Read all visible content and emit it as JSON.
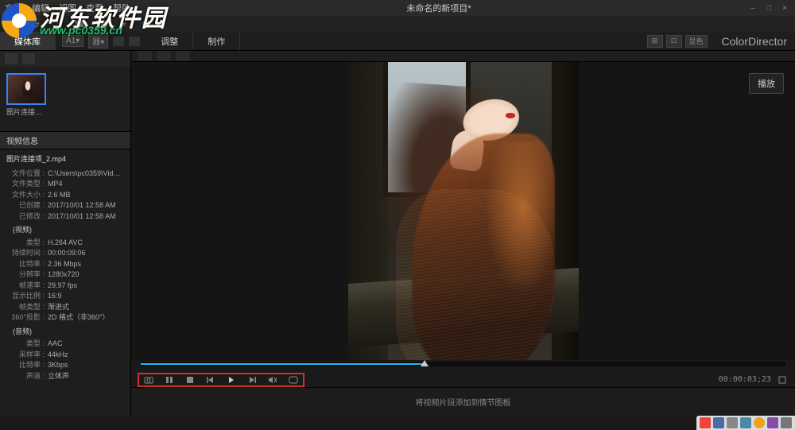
{
  "menubar": {
    "items": [
      "文件",
      "编辑",
      "视图",
      "查看",
      "帮助"
    ],
    "title": "未命名的新项目*",
    "win": [
      "–",
      "□",
      "×"
    ]
  },
  "tabs": {
    "media": "媒体库",
    "adjust": "调整",
    "make": "制作"
  },
  "subtool": {
    "dd1": "A1▾",
    "dd2": "器▾"
  },
  "brand": "ColorDirector",
  "right_icons": {
    "a": "⊞",
    "b": "⊡",
    "c": "显色"
  },
  "thumb": {
    "label": "图片连接项_2..."
  },
  "section_head": "视频信息",
  "info": {
    "file_title": "图片连接项_2.mp4",
    "rows_file": [
      {
        "k": "文件位置",
        "v": "C:\\Users\\pc0359\\Videos..."
      },
      {
        "k": "文件类型",
        "v": "MP4"
      },
      {
        "k": "文件大小",
        "v": "2.6 MB"
      },
      {
        "k": "已创建",
        "v": "2017/10/01 12:58 AM"
      },
      {
        "k": "已修改",
        "v": "2017/10/01 12:58 AM"
      }
    ],
    "grp_video": "(视频)",
    "rows_video": [
      {
        "k": "类型",
        "v": "H.264 AVC"
      },
      {
        "k": "持续时间",
        "v": "00:00:09:06"
      },
      {
        "k": "比特率",
        "v": "2.36 Mbps"
      },
      {
        "k": "分辨率",
        "v": "1280x720"
      },
      {
        "k": "帧速率",
        "v": "29.97 fps"
      },
      {
        "k": "显示比例",
        "v": "16:9"
      },
      {
        "k": "帧类型",
        "v": "渐进式"
      },
      {
        "k": "360°投影",
        "v": "2D 格式（非360°）"
      }
    ],
    "grp_audio": "(音频)",
    "rows_audio": [
      {
        "k": "类型",
        "v": "AAC"
      },
      {
        "k": "采样率",
        "v": "44kHz"
      },
      {
        "k": "比特率",
        "v": "3Kbps"
      },
      {
        "k": "声道",
        "v": "立体声"
      }
    ]
  },
  "preview": {
    "play_label": "播放"
  },
  "transport": {
    "timecode": "00:00:03;23"
  },
  "drop_hint": "将视频片段添加到情节图板",
  "watermark": {
    "zh": "河东软件园",
    "url": "www.pc0359.cn"
  }
}
